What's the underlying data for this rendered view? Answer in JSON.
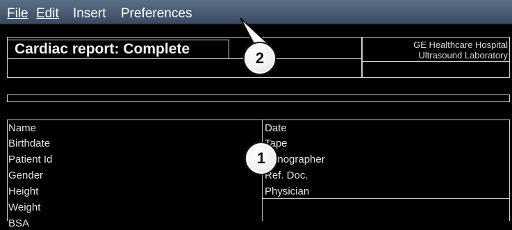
{
  "menu": {
    "file": "File",
    "edit": "Edit",
    "insert": "Insert",
    "preferences": "Preferences"
  },
  "report": {
    "title": "Cardiac report: Complete",
    "hospital_line1": "GE Healthcare Hospital",
    "hospital_line2": "Ultrasound Laboratory"
  },
  "patient_fields": [
    "Name",
    "Birthdate",
    "Patient Id",
    "Gender",
    "Height",
    "Weight",
    "BSA"
  ],
  "exam_fields": [
    "Date",
    "Tape",
    "Sonographer",
    "Ref. Doc.",
    "Physician"
  ],
  "callouts": {
    "one": "1",
    "two": "2"
  }
}
